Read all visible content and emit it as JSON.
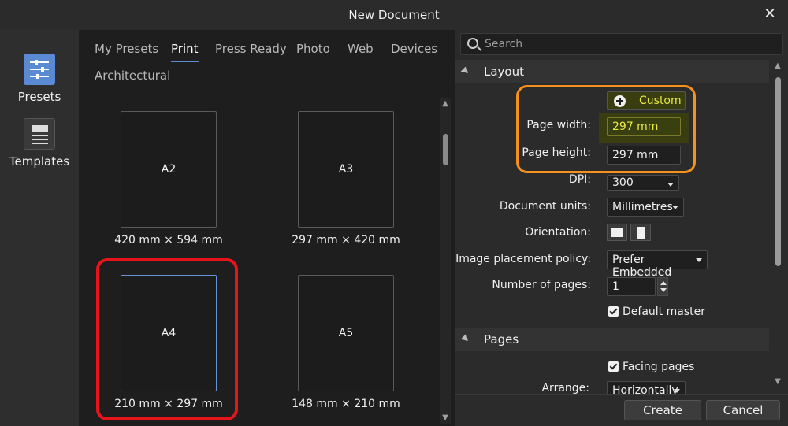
{
  "window": {
    "title": "New Document",
    "close_label": "✕"
  },
  "leftbar": {
    "presets_label": "Presets",
    "templates_label": "Templates"
  },
  "tabs": [
    "My Presets",
    "Print",
    "Press Ready",
    "Photo",
    "Web",
    "Devices",
    "Architectural"
  ],
  "active_tab": "Print",
  "presets": [
    {
      "name": "A2",
      "dims": "420 mm × 594 mm"
    },
    {
      "name": "A3",
      "dims": "297 mm × 420 mm"
    },
    {
      "name": "A4",
      "dims": "210 mm × 297 mm"
    },
    {
      "name": "A5",
      "dims": "148 mm × 210 mm"
    }
  ],
  "selected_preset": "A4",
  "search": {
    "placeholder": "Search"
  },
  "layout": {
    "section_title": "Layout",
    "custom_label": "Custom",
    "page_width_label": "Page width:",
    "page_width_value": "297 mm",
    "page_height_label": "Page height:",
    "page_height_value": "297 mm",
    "dpi_label": "DPI:",
    "dpi_value": "300",
    "units_label": "Document units:",
    "units_value": "Millimetres",
    "orientation_label": "Orientation:",
    "placement_label": "Image placement policy:",
    "placement_value": "Prefer Embedded",
    "pages_label": "Number of pages:",
    "pages_value": "1",
    "default_master_label": "Default master"
  },
  "pages": {
    "section_title": "Pages",
    "facing_label": "Facing pages",
    "arrange_label": "Arrange:",
    "arrange_value": "Horizontally"
  },
  "footer": {
    "create_label": "Create",
    "cancel_label": "Cancel"
  },
  "colors": {
    "accent": "#5a8ad4",
    "highlight_red": "#e8141c",
    "highlight_orange": "#f5921e",
    "custom_text": "#e8e840"
  }
}
